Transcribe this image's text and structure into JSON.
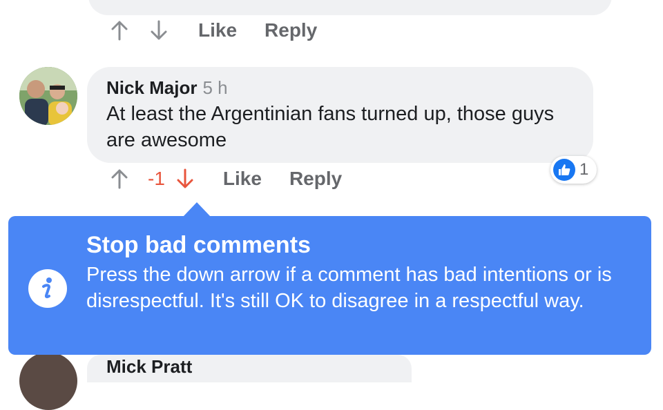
{
  "previous_comment": {
    "like_label": "Like",
    "reply_label": "Reply"
  },
  "comment": {
    "author": "Nick Major",
    "timestamp": "5 h",
    "text": "At least the Argentinian fans turned up, those guys are awesome",
    "vote_score": "-1",
    "like_label": "Like",
    "reply_label": "Reply",
    "reaction_count": "1"
  },
  "tooltip": {
    "title": "Stop bad comments",
    "body": "Press the down arrow if a comment has bad intentions or is disrespectful. It's still OK to disagree in a respectful way."
  },
  "next_comment": {
    "author": "Mick Pratt"
  },
  "colors": {
    "accent": "#4a86f5",
    "downvote": "#e8553c",
    "muted": "#65676b",
    "bubble": "#f0f1f3",
    "like_blue": "#1877f2"
  }
}
